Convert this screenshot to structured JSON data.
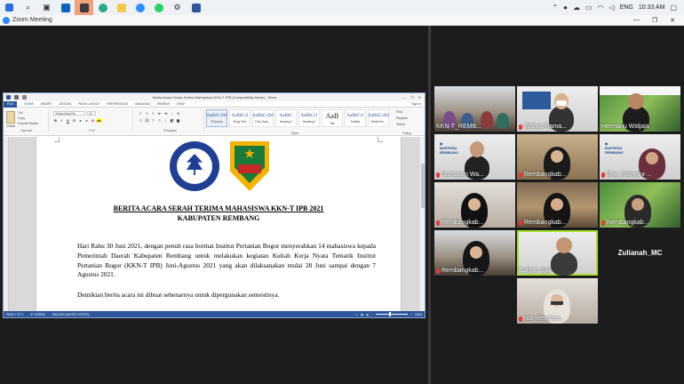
{
  "taskbar": {
    "lang": "ENG",
    "time": "10:33 AM",
    "apps": [
      "start-icon",
      "search-icon",
      "task-view-icon",
      "outlook-icon",
      "app-orange-icon",
      "edge-icon",
      "file-explorer-icon",
      "zoom-icon",
      "whatsapp-icon",
      "settings-icon",
      "word-icon"
    ]
  },
  "zoom": {
    "window_title": "Zoom Meeting"
  },
  "word": {
    "title": "Berita Acara Serah Terima Mahasiswa KKN-T IPB (Compatibility Mode) - Word",
    "tabs": [
      "FILE",
      "HOME",
      "INSERT",
      "DESIGN",
      "PAGE LAYOUT",
      "REFERENCES",
      "MAILINGS",
      "REVIEW",
      "VIEW"
    ],
    "signin": "Sign in",
    "font_name": "Times New Ro",
    "font_size": "12",
    "clipboard": {
      "cut": "Cut",
      "copy": "Copy",
      "painter": "Format Painter",
      "paste": "Paste"
    },
    "groups": {
      "clipboard": "Clipboard",
      "font": "Font",
      "paragraph": "Paragraph",
      "styles": "Styles",
      "editing": "Editing"
    },
    "styles": [
      {
        "sample": "AaBbCcDd",
        "name": "¶ Normal"
      },
      {
        "sample": "AaBbCcI",
        "name": "Body Text"
      },
      {
        "sample": "AaBbCcDd",
        "name": "¶ No Spac..."
      },
      {
        "sample": "AaBbC",
        "name": "Heading 1"
      },
      {
        "sample": "AaBbCcI",
        "name": "Heading 2"
      },
      {
        "sample": "AaB",
        "name": "Title"
      },
      {
        "sample": "AaBbCcI",
        "name": "Subtitle"
      },
      {
        "sample": "AaBbCcDd",
        "name": "Subtle Em..."
      }
    ],
    "editing": [
      "Find",
      "Replace",
      "Select"
    ],
    "doc": {
      "heading1": "BERITA ACARA SERAH TERIMA MAHASISWA KKN-T IPB 2021",
      "heading2": "KABUPATEN REMBANG",
      "para1": "Hari Rabu 30 Juni 2021, dengan penuh rasa hormat Institut Pertanian Bogor menyerahkan 14 mahasiswa kepada Pemerintah Daerah Kabupaten Rembang untuk melakukan kegiatan Kuliah Kerja Nyata Tematik Institut Pertanian Bogor (KKN-T IPB) Juni-Agustus 2021 yang akan dilaksanakan mulai 28 Juni sampai dengan 7 Agustus 2021.",
      "para2": "Demikian berita acara ini dibuat sebenarnya untuk dipergunakan semestinya."
    },
    "status": {
      "page": "PAGE 1 OF 1",
      "words": "97 WORDS",
      "lang": "ENGLISH (UNITED STATES)",
      "zoom": "140%"
    }
  },
  "participants": [
    {
      "name": "KKN-T_REMB...",
      "muted": false
    },
    {
      "name": "Wahyu Rama...",
      "muted": true
    },
    {
      "name": "Hermanu Widjaja",
      "muted": false
    },
    {
      "name": "Nursalam Wa...",
      "muted": true
    },
    {
      "name": "Rembangkab...",
      "muted": true
    },
    {
      "name": "Dwi_Wahyuni-...",
      "muted": true
    },
    {
      "name": "Rembangkab...",
      "muted": true
    },
    {
      "name": "Rembangkab...",
      "muted": true
    },
    {
      "name": "Rembangkab...",
      "muted": true
    },
    {
      "name": "Rembangkab...",
      "muted": true
    },
    {
      "name": "Sofyan Sjaf",
      "muted": false
    },
    {
      "name": "Zulianah_MC",
      "muted": false
    },
    {
      "name": "nur_Remban...",
      "muted": true
    }
  ],
  "colors": {
    "word_blue": "#2b579a",
    "active_speaker": "#a6e22e",
    "zoom_blue": "#2d8cff"
  }
}
